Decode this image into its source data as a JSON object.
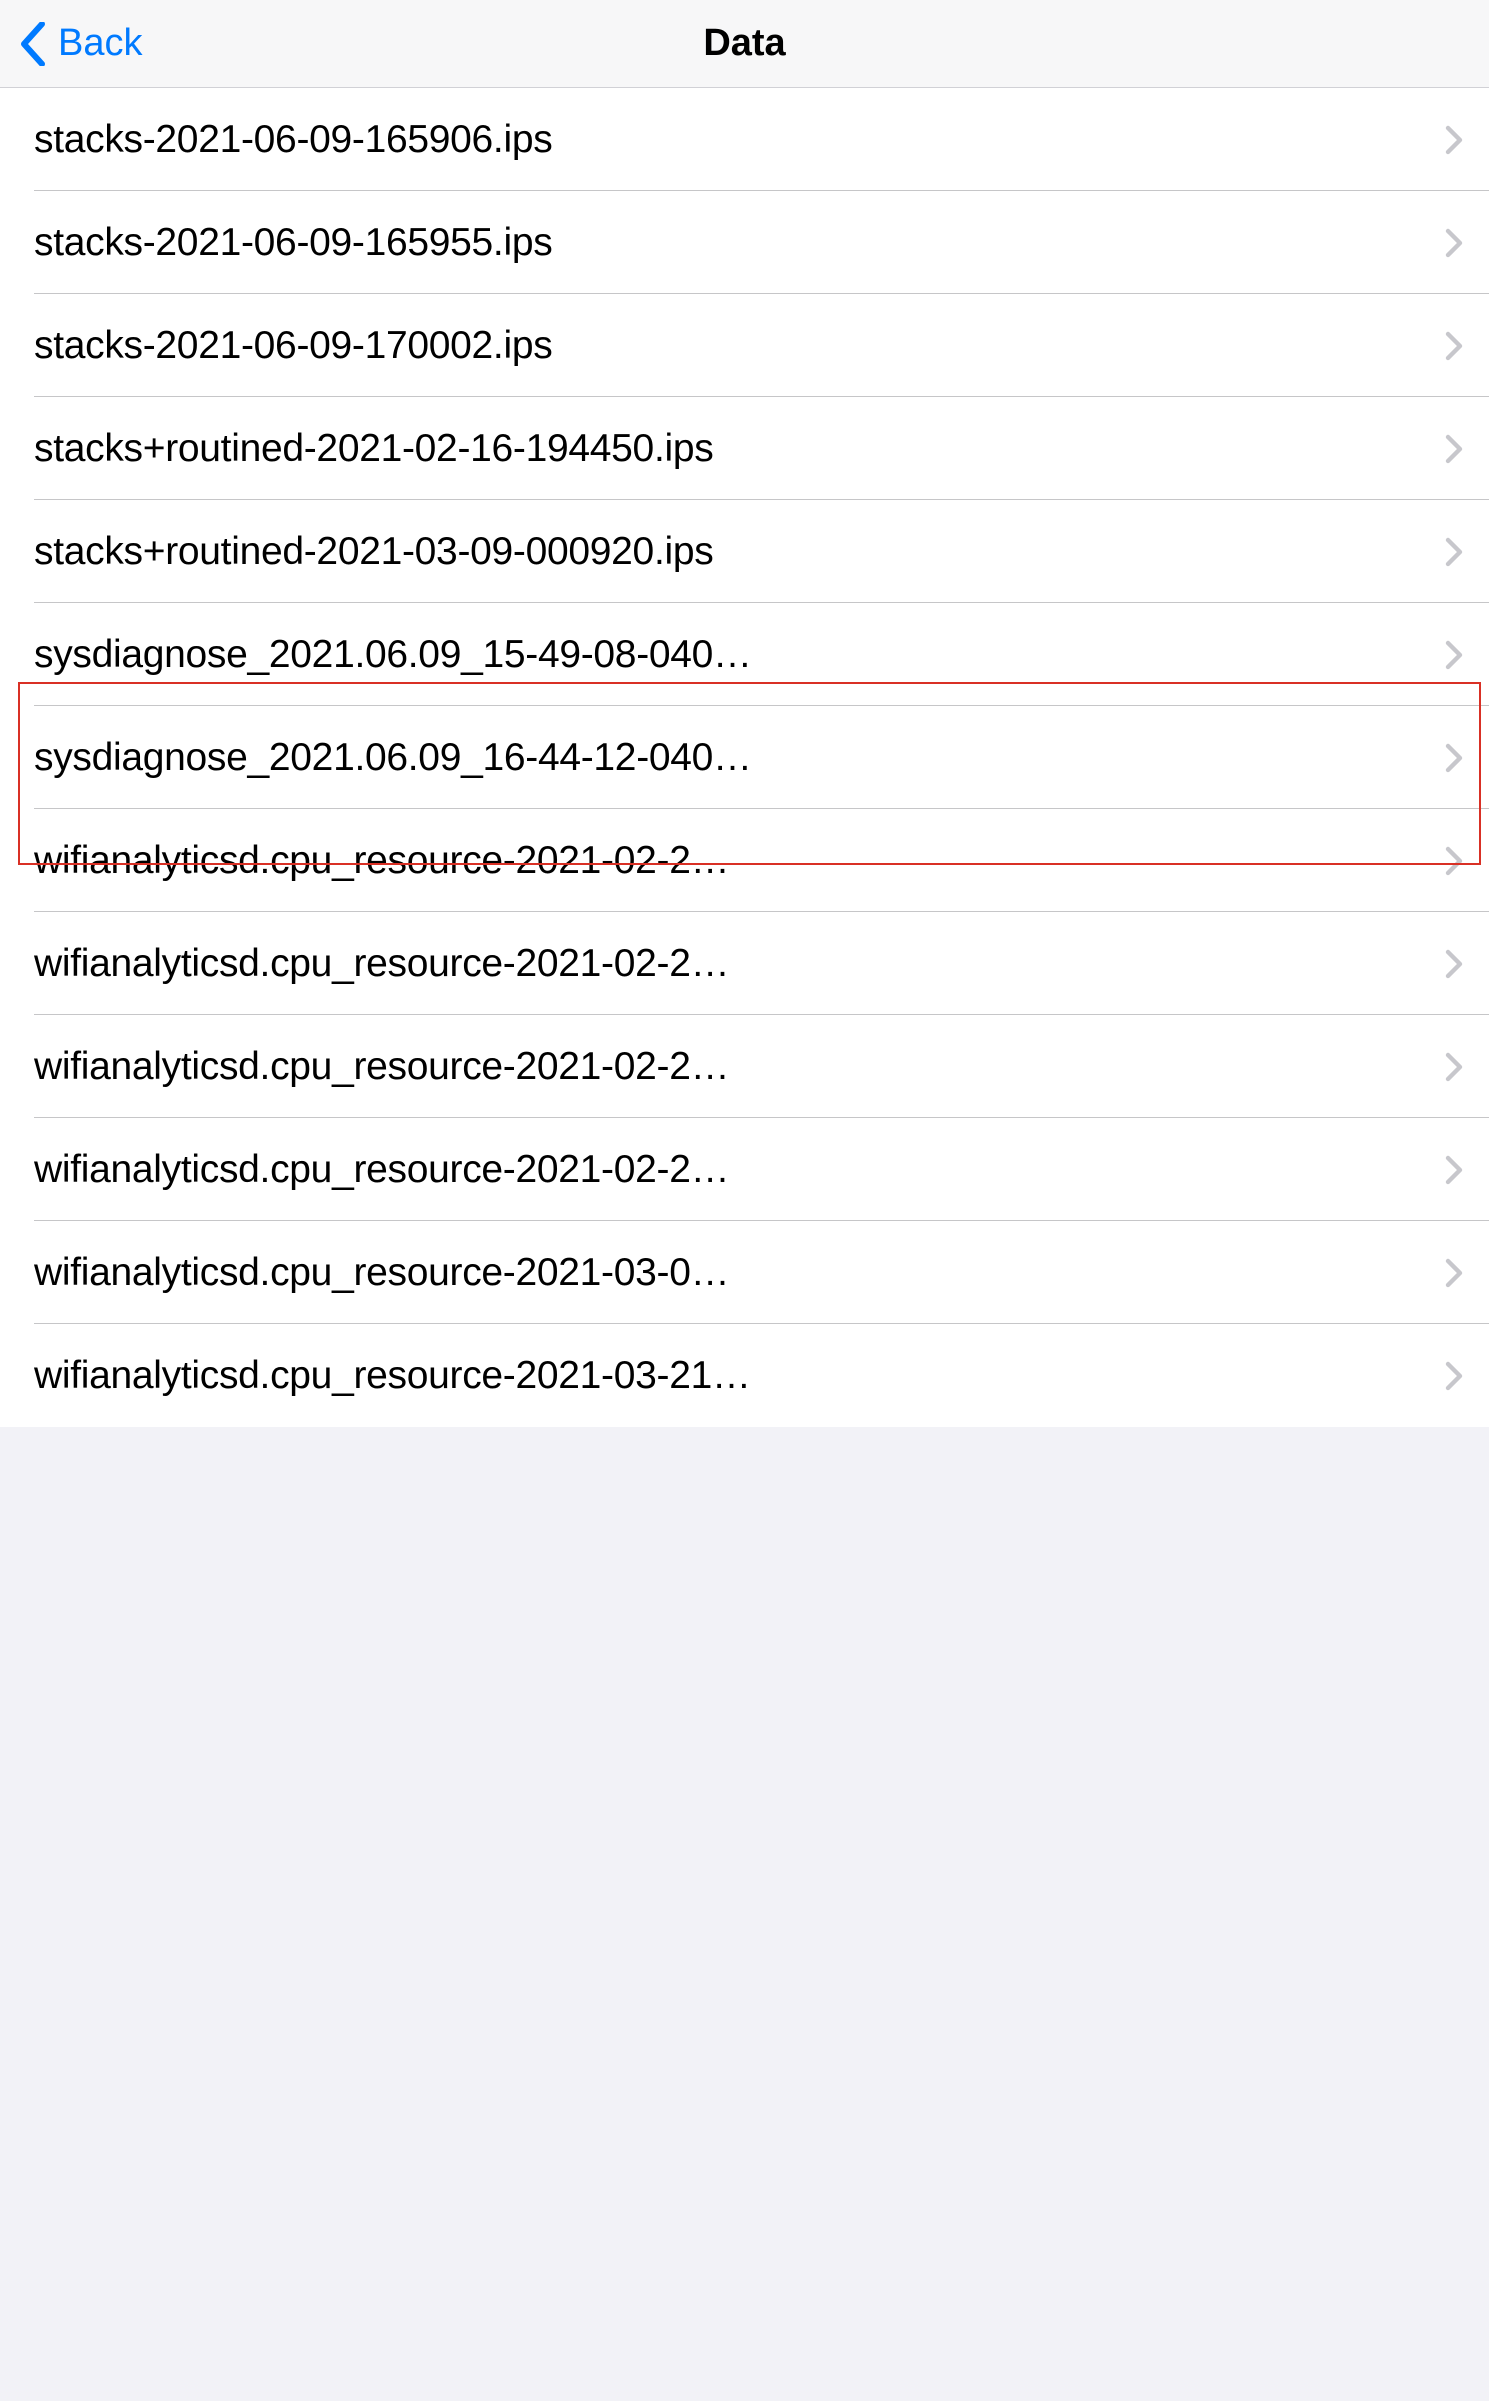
{
  "nav": {
    "back_label": "Back",
    "title": "Data"
  },
  "rows": [
    {
      "label": "stacks-2021-06-09-165906.ips"
    },
    {
      "label": "stacks-2021-06-09-165955.ips"
    },
    {
      "label": "stacks-2021-06-09-170002.ips"
    },
    {
      "label": "stacks+routined-2021-02-16-194450.ips"
    },
    {
      "label": "stacks+routined-2021-03-09-000920.ips"
    },
    {
      "label": "sysdiagnose_2021.06.09_15-49-08-040…"
    },
    {
      "label": "sysdiagnose_2021.06.09_16-44-12-040…"
    },
    {
      "label": "wifianalyticsd.cpu_resource-2021-02-2…"
    },
    {
      "label": "wifianalyticsd.cpu_resource-2021-02-2…"
    },
    {
      "label": "wifianalyticsd.cpu_resource-2021-02-2…"
    },
    {
      "label": "wifianalyticsd.cpu_resource-2021-02-2…"
    },
    {
      "label": "wifianalyticsd.cpu_resource-2021-03-0…"
    },
    {
      "label": "wifianalyticsd.cpu_resource-2021-03-21…"
    }
  ],
  "highlight": {
    "start_index": 5,
    "end_index": 6
  }
}
